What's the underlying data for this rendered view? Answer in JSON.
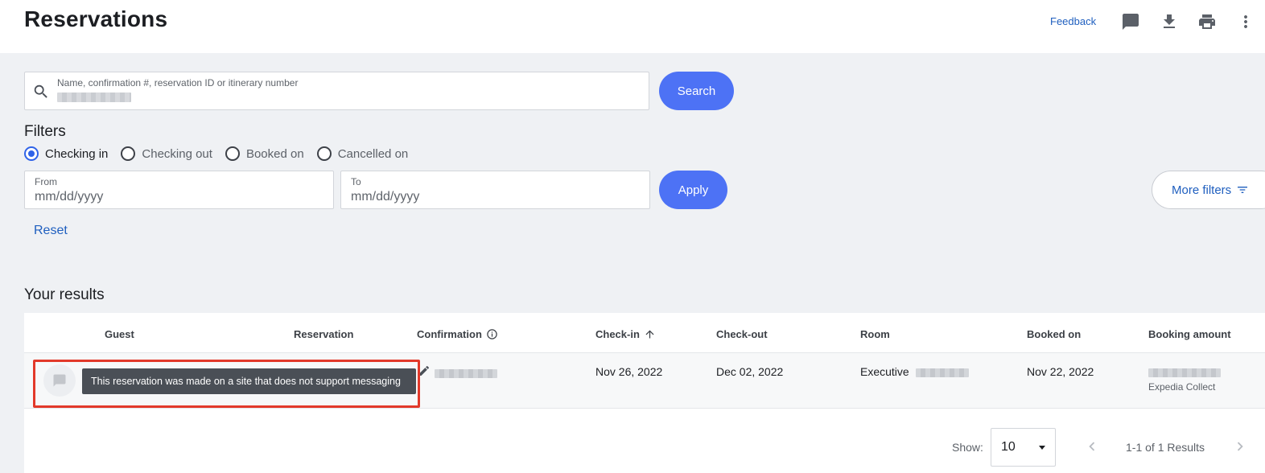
{
  "header": {
    "title": "Reservations",
    "feedback_label": "Feedback",
    "icons": [
      "chat-icon",
      "download-icon",
      "print-icon",
      "more-vert-icon"
    ]
  },
  "search": {
    "label": "Name, confirmation #, reservation ID or itinerary number",
    "value": "redacted",
    "button_label": "Search"
  },
  "filters": {
    "title": "Filters",
    "options": [
      {
        "label": "Checking in",
        "selected": true
      },
      {
        "label": "Checking out",
        "selected": false
      },
      {
        "label": "Booked on",
        "selected": false
      },
      {
        "label": "Cancelled on",
        "selected": false
      }
    ],
    "from": {
      "label": "From",
      "placeholder": "mm/dd/yyyy"
    },
    "to": {
      "label": "To",
      "placeholder": "mm/dd/yyyy"
    },
    "apply_label": "Apply",
    "more_filters_label": "More filters",
    "reset_label": "Reset"
  },
  "results": {
    "title": "Your results",
    "columns": [
      "Guest",
      "Reservation",
      "Confirmation",
      "Check-in",
      "Check-out",
      "Room",
      "Booked on",
      "Booking amount"
    ],
    "rows": [
      {
        "guest": "redacted",
        "reservation": "redacted",
        "confirmation": "redacted",
        "check_in": "Nov 26, 2022",
        "check_out": "Dec 02, 2022",
        "room": "Executive",
        "room_detail": "redacted",
        "booked_on": "Nov 22, 2022",
        "booking_amount": "redacted",
        "payment_type": "Expedia Collect"
      }
    ],
    "tooltip": "This reservation was made on a site that does not support messaging",
    "sort": {
      "column": "Check-in",
      "direction": "ascending"
    }
  },
  "pagination": {
    "show_label": "Show:",
    "page_size": "10",
    "summary": "1-1 of 1 Results"
  },
  "colors": {
    "accent": "#4d72f5",
    "link": "#1f5fbf",
    "highlight": "#e2392a",
    "tooltip_bg": "#4a4f56",
    "page_bg": "#eff1f4"
  }
}
